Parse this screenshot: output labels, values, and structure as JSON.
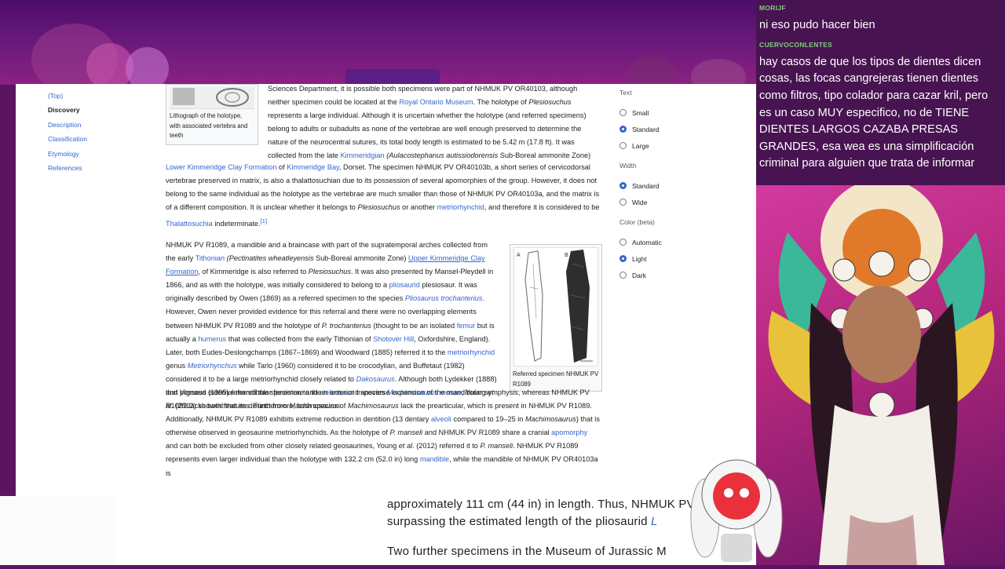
{
  "toc": {
    "items": [
      {
        "label": "(Top)",
        "current": false
      },
      {
        "label": "Discovery",
        "current": true
      },
      {
        "label": "Description",
        "current": false
      },
      {
        "label": "Classification",
        "current": false
      },
      {
        "label": "Etymology",
        "current": false
      },
      {
        "label": "References",
        "current": false
      }
    ]
  },
  "thumb1": {
    "caption": "Lithograph of the holotype, with associated vertebra and teeth"
  },
  "thumb2": {
    "caption": "Referred specimen NHMUK PV R1089",
    "label_a": "A",
    "label_b": "B"
  },
  "article": {
    "p1_line_intro": "Sciences Department, it is possible both specimens were part of NHMUK PV OR40103, although neither specimen could be located at the",
    "p1_link_rom": "Royal Ontario Museum",
    "p1_holotype": ". The holotype of",
    "p1_plesio": "Plesiosuchus",
    "p1_rest": "represents a large individual. Although it is uncertain whether the holotype (and referred specimens) belong to adults or subadults as none of the vertebrae are well enough preserved to determine the nature of the neurocentral sutures, its total body length is estimated to be 5.42 m (17.8 ft). It was collected from the late",
    "p1_link_kimm": "Kimmeridgian",
    "p1_zone": "(Aulacostephanus autissiodorensis",
    "p1_zone_rest": "Sub-Boreal ammonite Zone)",
    "p1_link_lkcf": "Lower Kimmeridge Clay Formation",
    "p1_of": "of",
    "p1_link_bay": "Kimmeridge Bay",
    "p1_b1": ", Dorset. The specimen NHMUK PV OR40103b, a short series of cervicodorsal vertebrae preserved in matrix, is also a thalattosuchian due to its possession of several apomorphies of the group. However, it does not belong to the same individual as the holotype as the vertebrae are much smaller than those of NHMUK PV OR40103a, and the matrix is of a different composition. It is unclear whether it belongs to",
    "p1_b2": "or another",
    "p1_link_metrio": "metriorhynchid",
    "p1_b3": ", and therefore it is considered to be",
    "p1_link_thal": "Thalattosuchia",
    "p1_b4": "indeterminate.",
    "p1_ref": "[1]",
    "p2_a": "NHMUK PV R1089, a mandible and a braincase with part of the supratemporal arches collected from the early",
    "p2_link_tith": "Tithonian",
    "p2_b": "(Pectinatites wheatleyensis",
    "p2_c": "Sub-Boreal ammonite Zone)",
    "p2_link_ukcf": "Upper Kimmeridge Clay Formation",
    "p2_d": ", of Kimmeridge is also referred to",
    "p2_e": ". It was also presented by Mansel-Pleydell in 1866, and as with the holotype, was initially considered to belong to a",
    "p2_link_plio": "pliosaurid",
    "p2_f": "plesiosaur. It was originally described by Owen (1869) as a referred specimen to the species",
    "p2_link_ptroch": "Pliosaurus trochanterius",
    "p2_g": ". However, Owen never provided evidence for this referral and there were no overlapping elements between NHMUK PV R1089 and the holotype of",
    "p2_ptroch2": "P. trochanterius",
    "p2_h": "(thought to be an isolated",
    "p2_link_femur": "femur",
    "p2_i": "but is actually a",
    "p2_link_hum": "humerus",
    "p2_j": "that was collected from the early Tithonian of",
    "p2_link_shot": "Shotover Hill",
    "p2_k": ", Oxfordshire, England). Later, both Eudes-Deslongchamps (1867–1869) and Woodward (1885) referred it to the",
    "p2_link_metrio2": "metriorhynchid",
    "p2_l": "genus",
    "p2_link_metgen": "Metriorhynchus",
    "p2_m": "while Tarlo (1960) considered it to be crocodylian, and Buffetaut (1982) considered it to be a large metriorhynchid closely related to",
    "p2_link_dako": "Dakosaurus",
    "p2_n": ". Although both Lydekker (1888) and Vignaud (1995) referred the specimen to the",
    "p2_link_teleo": "teleosaurid",
    "p2_o": "species",
    "p2_link_mach": "Machimosaurus mosae",
    "p2_p": ", Young",
    "p2_etal": "et al.",
    "p2_q": "(2012) showed that its distinct from",
    "p2_mach2": "Machimosaurus",
    "p2_r": "that possess external mandibular fenestrae and an anterior transverse expansion of the mandibular symphysis, whereas NHMUK PV R1089 lacks both features. Furthermore, both species of",
    "p2_s": "lack the prearticular, which is present in NHMUK PV R1089. Additionally, NHMUK PV R1089 exhibits extreme reduction in dentition (13 dentary",
    "p2_link_alv": "alveoli",
    "p2_t": "compared to 19–25 in",
    "p2_u": ") that is otherwise observed in geosaurine metriorhynchids. As the holotype of",
    "p2_pmans": "P. manseli",
    "p2_v": "and NHMUK PV R1089 share a cranial",
    "p2_link_apo": "apomorphy",
    "p2_w": "and can both be excluded from other closely related geosaurines, Young",
    "p2_x": "(2012) referred it to",
    "p2_y": ". NHMUK PV R1089 represents even larger individual than the holotype with 132.2 cm (52.0 in) long",
    "p2_link_mand": "mandible",
    "p2_z": ", while the mandible of NHMUK PV OR40103a is"
  },
  "appearance": {
    "text": {
      "heading": "Text",
      "options": [
        "Small",
        "Standard",
        "Large"
      ],
      "selected": "Standard"
    },
    "width": {
      "heading": "Width",
      "options": [
        "Standard",
        "Wide"
      ],
      "selected": "Standard"
    },
    "color": {
      "heading": "Color (beta)",
      "options": [
        "Automatic",
        "Light",
        "Dark"
      ],
      "selected": "Light"
    }
  },
  "lower": {
    "line1": "approximately 111 cm (44 in) in length. Thus, NHMUK PV",
    "line2": "surpassing the estimated length of the pliosaurid",
    "line2_tail": "L",
    "line3": "Two further specimens in the Museum of Jurassic M"
  },
  "chat": [
    {
      "user": "MORIJF",
      "message": "ni eso pudo hacer bien"
    },
    {
      "user": "CUERVOCONLENTES",
      "message": "hay casos de que los tipos de dientes dicen cosas, las focas cangrejeras tienen dientes como filtros, tipo colador para cazar kril, pero es un caso MUY especifico, no de TIENE DIENTES LARGOS CAZABA PRESAS GRANDES, esa wea es una simplificación criminal para alguien que trata de informar"
    }
  ],
  "colors": {
    "link": "#3366cc",
    "chat_user": "#7fd07a",
    "stream_bg": "#5a1460"
  }
}
